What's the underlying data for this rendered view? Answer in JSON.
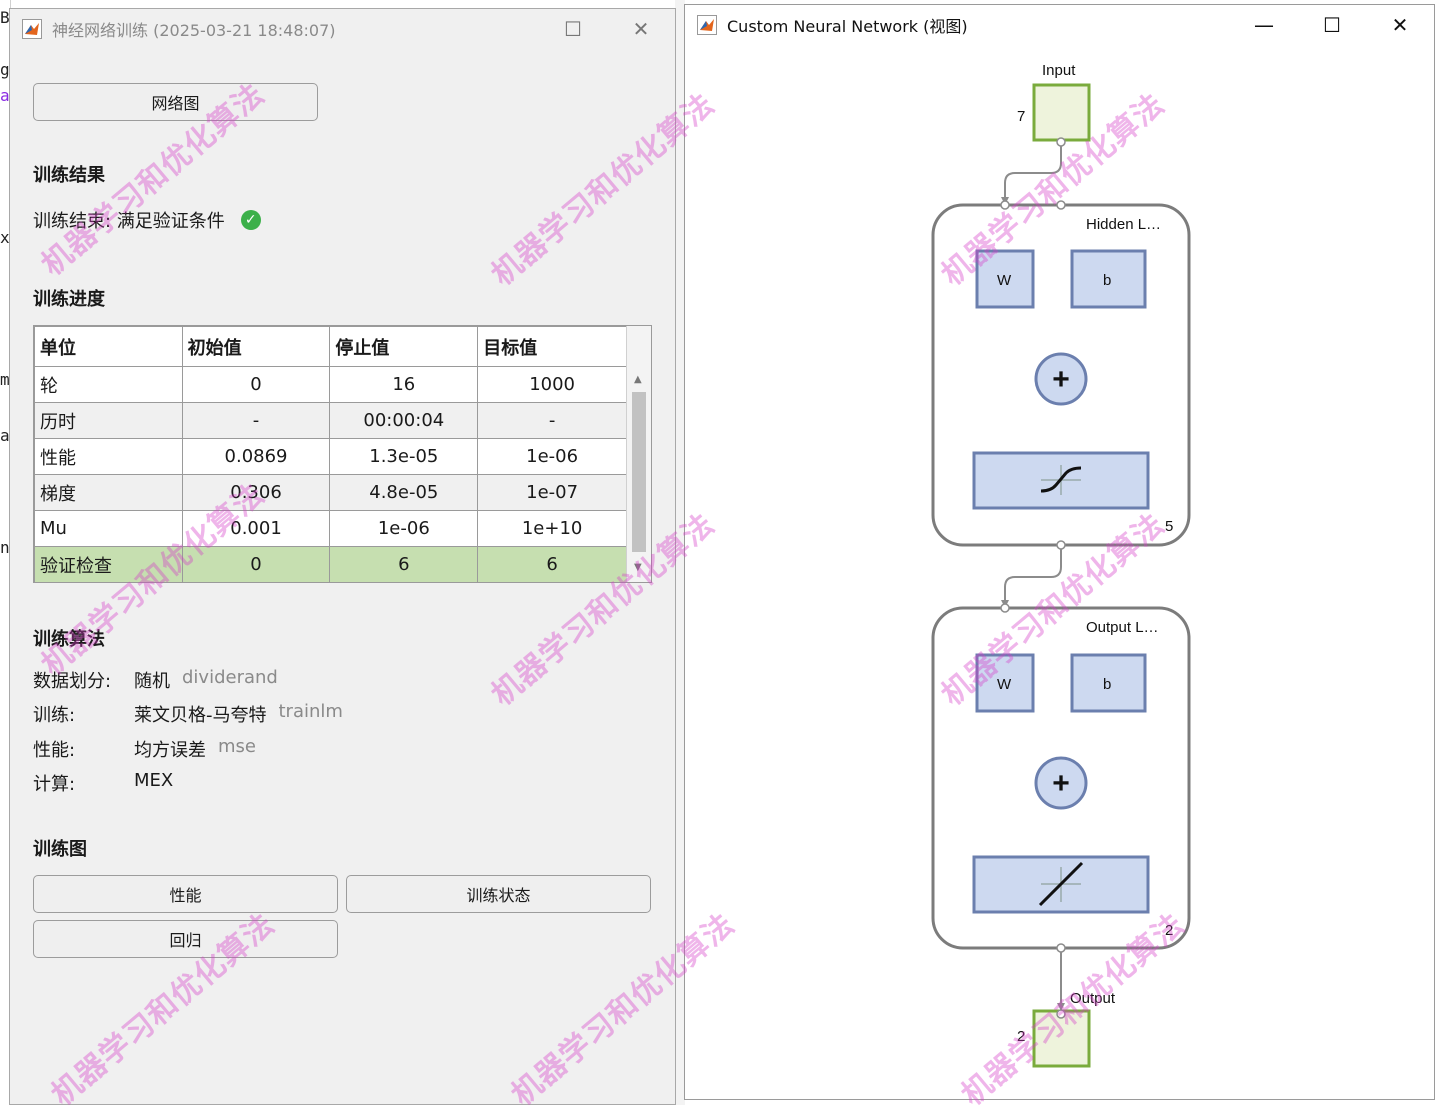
{
  "training_window": {
    "title": "神经网络训练 (2025-03-21 18:48:07)",
    "network_view_button": "网络图",
    "results_heading": "训练结果",
    "status_text": "训练结束: 满足验证条件",
    "progress_heading": "训练进度",
    "progress_table": {
      "headers": [
        "单位",
        "初始值",
        "停止值",
        "目标值"
      ],
      "rows": [
        {
          "unit": "轮",
          "initial": "0",
          "stop": "16",
          "target": "1000"
        },
        {
          "unit": "历时",
          "initial": "-",
          "stop": "00:00:04",
          "target": "-"
        },
        {
          "unit": "性能",
          "initial": "0.0869",
          "stop": "1.3e-05",
          "target": "1e-06"
        },
        {
          "unit": "梯度",
          "initial": "0.306",
          "stop": "4.8e-05",
          "target": "1e-07"
        },
        {
          "unit": "Mu",
          "initial": "0.001",
          "stop": "1e-06",
          "target": "1e+10"
        },
        {
          "unit": "验证检查",
          "initial": "0",
          "stop": "6",
          "target": "6"
        }
      ]
    },
    "algorithm_heading": "训练算法",
    "algorithms": [
      {
        "label": "数据划分:",
        "value": "随机",
        "code": "dividerand"
      },
      {
        "label": "训练:",
        "value": "莱文贝格-马夸特",
        "code": "trainlm"
      },
      {
        "label": "性能:",
        "value": "均方误差",
        "code": "mse"
      },
      {
        "label": "计算:",
        "value": "MEX",
        "code": ""
      }
    ],
    "plots_heading": "训练图",
    "plot_buttons": {
      "performance": "性能",
      "training_state": "训练状态",
      "regression": "回归"
    }
  },
  "view_window": {
    "title": "Custom Neural Network (视图)",
    "input_label": "Input",
    "input_size": "7",
    "hidden_layer": {
      "title": "Hidden L…",
      "weight": "W",
      "bias": "b",
      "sum": "+",
      "size": "5",
      "transfer": "tansig"
    },
    "output_layer": {
      "title": "Output L…",
      "weight": "W",
      "bias": "b",
      "sum": "+",
      "size": "2",
      "transfer": "purelin"
    },
    "output_label": "Output",
    "output_size": "2"
  },
  "window_controls": {
    "minimize": "—",
    "maximize": "☐",
    "close": "✕"
  },
  "watermark": "机器学习和优化算法",
  "colors": {
    "status_ok": "#3cb04a",
    "highlight_row": "#c6dfb0",
    "node_fill": "#cdd9f0",
    "node_stroke": "#6b7fae",
    "io_fill": "#eef3dc",
    "io_stroke": "#7aab3c"
  }
}
